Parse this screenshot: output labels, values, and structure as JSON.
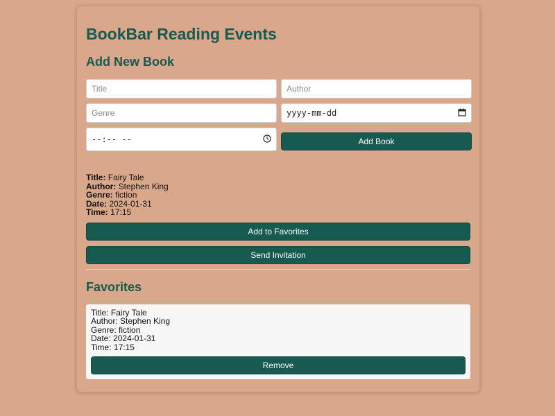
{
  "app": {
    "title": "BookBar Reading Events"
  },
  "form": {
    "heading": "Add New Book",
    "title_placeholder": "Title",
    "author_placeholder": "Author",
    "genre_placeholder": "Genre",
    "date_placeholder": "yyyy-mm-dd",
    "time_placeholder": "--:-- --",
    "add_button": "Add Book"
  },
  "book": {
    "title_label": "Title:",
    "title": "Fairy Tale",
    "author_label": "Author:",
    "author": "Stephen King",
    "genre_label": "Genre:",
    "genre": "fiction",
    "date_label": "Date:",
    "date": "2024-01-31",
    "time_label": "Time:",
    "time": "17:15",
    "favorite_button": "Add to Favorites",
    "invite_button": "Send Invitation"
  },
  "favorites": {
    "heading": "Favorites",
    "items": [
      {
        "title_line": "Title: Fairy Tale",
        "author_line": "Author: Stephen King",
        "genre_line": "Genre: fiction",
        "date_line": "Date: 2024-01-31",
        "time_line": "Time: 17:15",
        "remove_button": "Remove"
      }
    ]
  },
  "colors": {
    "background": "#d9a78a",
    "accent": "#165a52",
    "card": "#f7f7f7"
  },
  "icons": {
    "calendar": "calendar-icon",
    "clock": "clock-icon"
  }
}
